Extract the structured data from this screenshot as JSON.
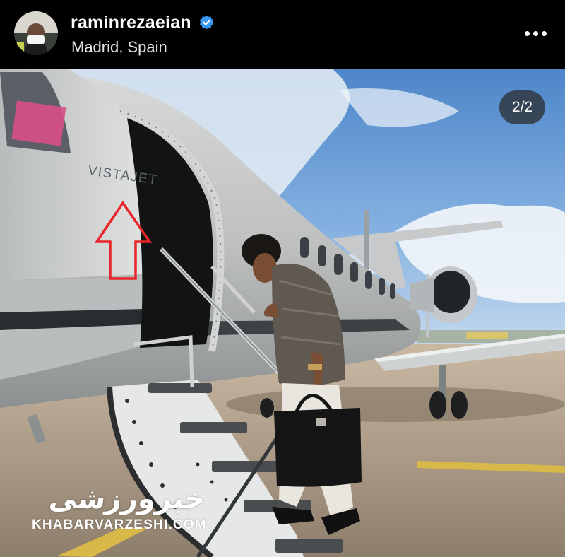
{
  "post": {
    "username": "raminrezaeian",
    "location": "Madrid, Spain",
    "verified": true,
    "media_counter": "2/2"
  },
  "image": {
    "plane_logo": "VISTAJET",
    "watermark_persian": "خبرورزشی",
    "watermark_text": "KHABARVARZESHI.COM"
  },
  "icons": {
    "verified": "verified-badge-icon",
    "more": "more-options-icon",
    "annotation": "red-up-arrow-icon"
  },
  "colors": {
    "verified_blue": "#3897f0",
    "annotation_red": "#e8262a",
    "background": "#000000"
  }
}
